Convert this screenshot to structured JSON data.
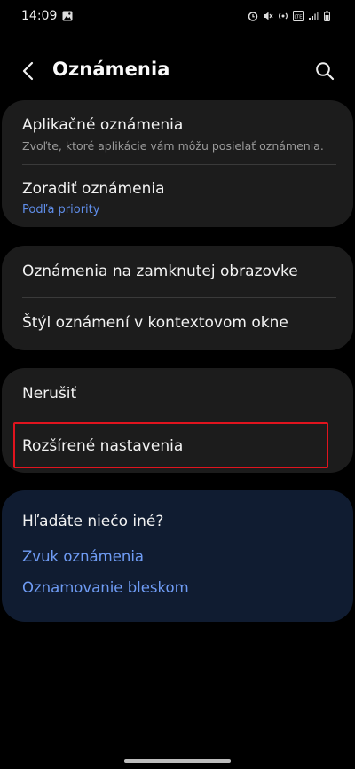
{
  "status": {
    "time": "14:09",
    "icons": [
      "image-icon",
      "alarm-icon",
      "mute-icon",
      "hotspot-icon",
      "volte-icon",
      "signal-icon",
      "battery-icon"
    ]
  },
  "header": {
    "title": "Oznámenia",
    "back_icon": "chevron-left-icon",
    "search_icon": "search-icon"
  },
  "group1": [
    {
      "title": "Aplikačné oznámenia",
      "subtitle": "Zvoľte, ktoré aplikácie vám môžu posielať oznámenia."
    },
    {
      "title": "Zoradiť oznámenia",
      "subtitle": "Podľa priority"
    }
  ],
  "group2": [
    {
      "title": "Oznámenia na zamknutej obrazovke"
    },
    {
      "title": "Štýl oznámení v kontextovom okne"
    }
  ],
  "group3": [
    {
      "title": "Nerušiť"
    },
    {
      "title": "Rozšírené nastavenia"
    }
  ],
  "suggestions": {
    "title": "Hľadáte niečo iné?",
    "links": [
      "Zvuk oznámenia",
      "Oznamovanie bleskom"
    ]
  },
  "colors": {
    "accent_link": "#6f9cf5",
    "highlight_box": "#e0141e",
    "card": "#1c1c1c",
    "suggestion_card": "#101c31"
  }
}
